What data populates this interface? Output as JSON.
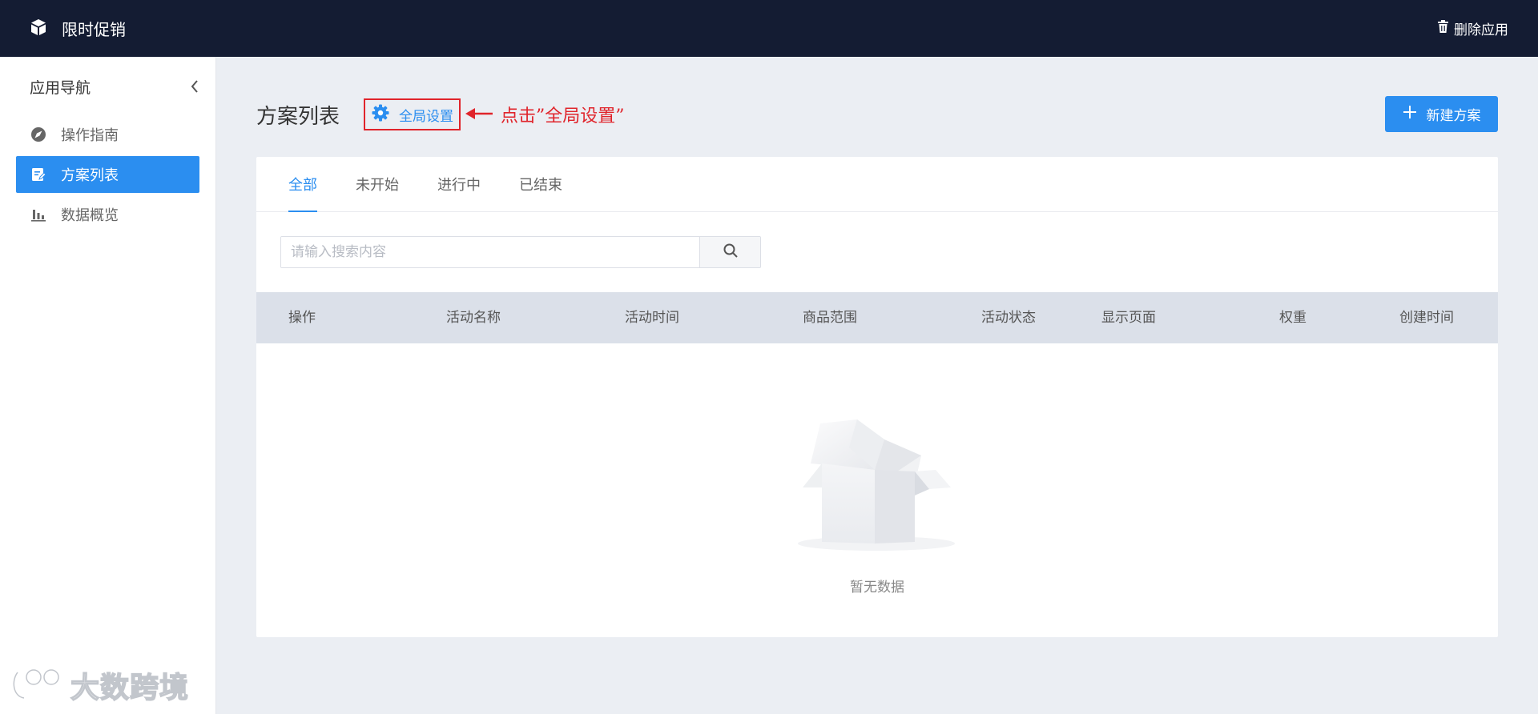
{
  "topbar": {
    "app_icon": "cube-icon",
    "title": "限时促销",
    "delete_icon": "trash-icon",
    "delete_label": "删除应用"
  },
  "sidebar": {
    "title": "应用导航",
    "collapse_icon": "chevron-left-icon",
    "items": [
      {
        "label": "操作指南",
        "icon": "compass-icon",
        "active": false
      },
      {
        "label": "方案列表",
        "icon": "edit-list-icon",
        "active": true
      },
      {
        "label": "数据概览",
        "icon": "bar-chart-icon",
        "active": false
      }
    ]
  },
  "main": {
    "title": "方案列表",
    "global_settings_label": "全局设置",
    "global_settings_icon": "gear-icon",
    "annotation": "点击”全局设置”",
    "new_plan_label": "新建方案",
    "new_plan_icon": "plus-icon",
    "tabs": [
      {
        "label": "全部",
        "active": true
      },
      {
        "label": "未开始",
        "active": false
      },
      {
        "label": "进行中",
        "active": false
      },
      {
        "label": "已结束",
        "active": false
      }
    ],
    "search": {
      "placeholder": "请输入搜索内容",
      "value": "",
      "icon": "search-icon"
    },
    "table": {
      "columns": [
        "操作",
        "活动名称",
        "活动时间",
        "商品范围",
        "活动状态",
        "显示页面",
        "权重",
        "创建时间"
      ],
      "rows": [],
      "empty_text": "暂无数据"
    }
  },
  "watermark": {
    "text": "大数跨境"
  },
  "colors": {
    "topbar": "#141c33",
    "accent": "#2b8ef0",
    "annotation": "#e0242b",
    "background": "#ebeef3"
  }
}
